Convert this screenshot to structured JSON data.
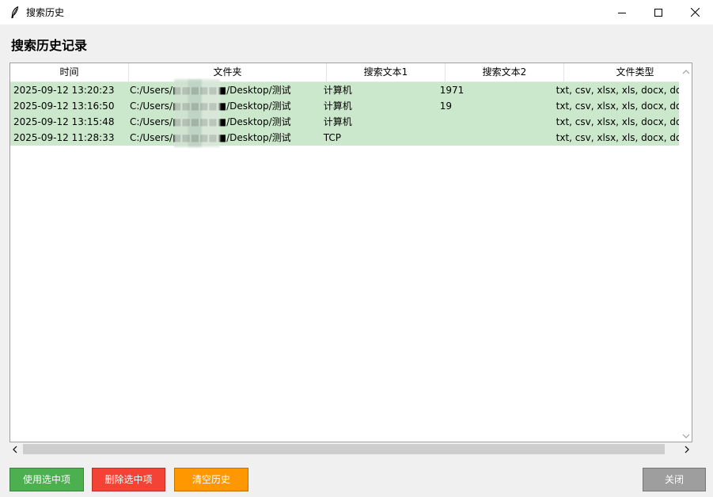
{
  "window": {
    "title": "搜索历史",
    "icon": "feather-icon"
  },
  "heading": "搜索历史记录",
  "table": {
    "columns": [
      "时间",
      "文件夹",
      "搜索文本1",
      "搜索文本2",
      "文件类型"
    ],
    "rows": [
      [
        "2025-09-12 13:20:23",
        "C:/Users/■■■■■■/Desktop/测试",
        "计算机",
        "1971",
        "txt, csv, xlsx, xls, docx, doc,"
      ],
      [
        "2025-09-12 13:16:50",
        "C:/Users/■■■■■■/Desktop/测试",
        "计算机",
        "19",
        "txt, csv, xlsx, xls, docx, doc,"
      ],
      [
        "2025-09-12 13:15:48",
        "C:/Users/■■■■■■/Desktop/测试",
        "计算机",
        "",
        "txt, csv, xlsx, xls, docx, doc,"
      ],
      [
        "2025-09-12 11:28:33",
        "C:/Users/■■■■■■/Desktop/测试",
        "TCP",
        "",
        "txt, csv, xlsx, xls, docx, doc,"
      ]
    ],
    "selected_row_color": "#cce8cc"
  },
  "buttons": {
    "use_selected": "使用选中项",
    "delete_selected": "删除选中项",
    "clear_history": "清空历史",
    "close": "关闭"
  },
  "colors": {
    "use_button": "#4caf50",
    "delete_button": "#f44336",
    "clear_button": "#ff9800",
    "close_button": "#9e9e9e"
  }
}
